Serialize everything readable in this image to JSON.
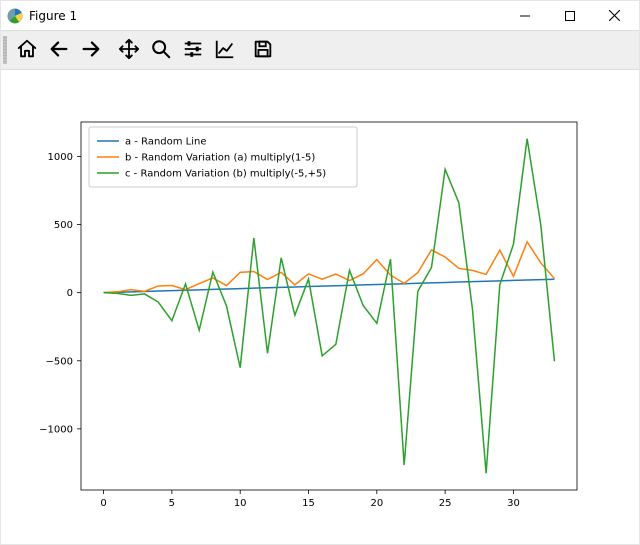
{
  "window": {
    "title": "Figure 1"
  },
  "toolbar": {
    "home": "Home",
    "back": "Back",
    "forward": "Forward",
    "pan": "Pan",
    "zoom": "Zoom",
    "configure": "Configure subplots",
    "edit": "Edit axis",
    "save": "Save"
  },
  "chart_data": {
    "type": "line",
    "xlabel": "",
    "ylabel": "",
    "title": "",
    "xlim": [
      -1.65,
      34.65
    ],
    "ylim": [
      -1448.63,
      1253.03
    ],
    "xticks": [
      0,
      5,
      10,
      15,
      20,
      25,
      30
    ],
    "yticks": [
      -1000,
      -500,
      0,
      500,
      1000
    ],
    "legend_position": "upper-left",
    "x": [
      0,
      1,
      2,
      3,
      4,
      5,
      6,
      7,
      8,
      9,
      10,
      11,
      12,
      13,
      14,
      15,
      16,
      17,
      18,
      19,
      20,
      21,
      22,
      23,
      24,
      25,
      26,
      27,
      28,
      29,
      30,
      31,
      32,
      33
    ],
    "series": [
      {
        "name": "a - Random Line",
        "color": "#1f77b4",
        "values": [
          0,
          3,
          6,
          9,
          12,
          15,
          18,
          21,
          24,
          27,
          30,
          33,
          36,
          39,
          42,
          45,
          48,
          51,
          54,
          57,
          60,
          63,
          66,
          69,
          72,
          75,
          78,
          81,
          84,
          87,
          90,
          93,
          96,
          99
        ]
      },
      {
        "name": "b - Random Variation (a) multiply(1-5)",
        "color": "#ff7f0e",
        "values": [
          0,
          6.4,
          22.0,
          9.5,
          49.5,
          52.3,
          22.3,
          66.6,
          108.0,
          52.5,
          149.1,
          155.4,
          96.5,
          149.5,
          57.3,
          138.6,
          99.2,
          137.0,
          88.9,
          138.3,
          243.1,
          129.1,
          68.6,
          147.3,
          314.0,
          261.8,
          178.7,
          163.4,
          134.1,
          312.3,
          120.0,
          373.2,
          219.2,
          103.3
        ]
      },
      {
        "name": "c - Random Variation (b) multiply(-5,+5)",
        "color": "#2ca02c",
        "values": [
          0,
          -5.4,
          -19.4,
          -9.1,
          -68.5,
          -205.7,
          64.7,
          -275.8,
          151.4,
          -98.9,
          -550.2,
          401.5,
          -445.1,
          255.6,
          -165.1,
          100.0,
          -464.1,
          -379.6,
          164.3,
          -94.1,
          -224.7,
          246.4,
          -1265.7,
          10.5,
          184.7,
          905.8,
          660.5,
          -121.8,
          -1325.9,
          57.9,
          356.1,
          1130.2,
          498.0,
          -503.4
        ]
      }
    ]
  }
}
